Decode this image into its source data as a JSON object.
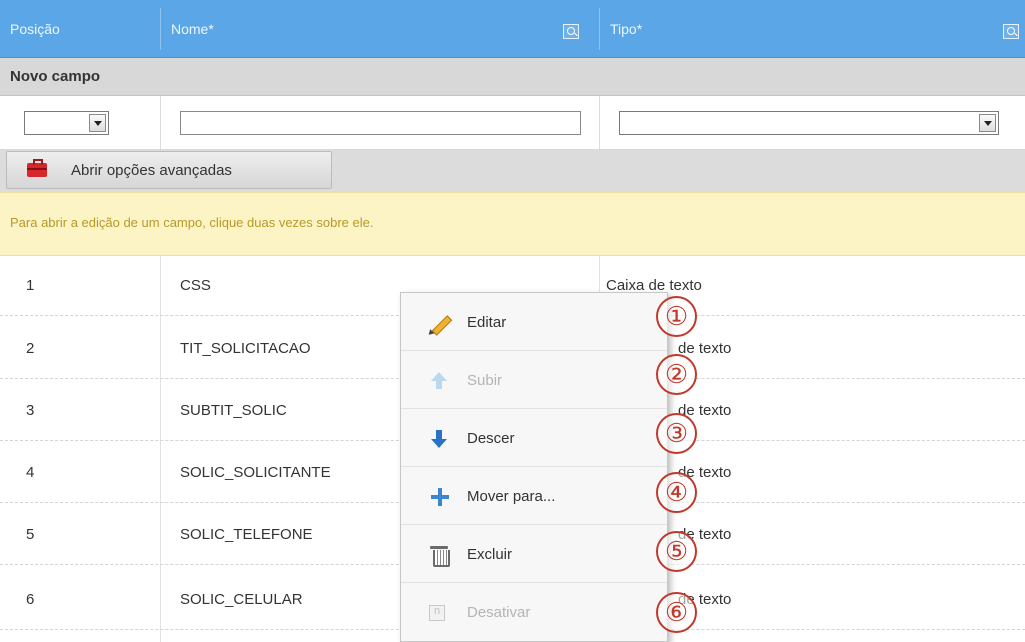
{
  "header": {
    "col_posicao": "Posição",
    "col_nome": "Nome*",
    "col_tipo": "Tipo*"
  },
  "new_field": {
    "title": "Novo campo",
    "posicao_value": "",
    "nome_value": "",
    "tipo_value": ""
  },
  "advanced": {
    "button_label": "Abrir opções avançadas"
  },
  "info": {
    "message": "Para abrir a edição de um campo, clique duas vezes sobre ele."
  },
  "rows": [
    {
      "posicao": "1",
      "nome": "CSS",
      "tipo": "Caixa de texto"
    },
    {
      "posicao": "2",
      "nome": "TIT_SOLICITACAO",
      "tipo": "de texto"
    },
    {
      "posicao": "3",
      "nome": "SUBTIT_SOLIC",
      "tipo": "de texto"
    },
    {
      "posicao": "4",
      "nome": "SOLIC_SOLICITANTE",
      "tipo": "de texto"
    },
    {
      "posicao": "5",
      "nome": "SOLIC_TELEFONE",
      "tipo": "de texto"
    },
    {
      "posicao": "6",
      "nome": "SOLIC_CELULAR",
      "tipo": "de texto"
    }
  ],
  "context_menu": {
    "items": [
      {
        "label": "Editar",
        "icon": "pencil-icon",
        "enabled": true
      },
      {
        "label": "Subir",
        "icon": "arrow-up-icon",
        "enabled": false
      },
      {
        "label": "Descer",
        "icon": "arrow-down-icon",
        "enabled": true
      },
      {
        "label": "Mover para...",
        "icon": "move-icon",
        "enabled": true
      },
      {
        "label": "Excluir",
        "icon": "trash-icon",
        "enabled": true
      },
      {
        "label": "Desativar",
        "icon": "disable-icon",
        "enabled": false
      }
    ]
  },
  "callouts": [
    "①",
    "②",
    "③",
    "④",
    "⑤",
    "⑥"
  ],
  "colors": {
    "header_bg": "#5aa6e6",
    "info_bg": "#fcf4c4",
    "info_text": "#b59a2a",
    "callout": "#c0392b"
  }
}
